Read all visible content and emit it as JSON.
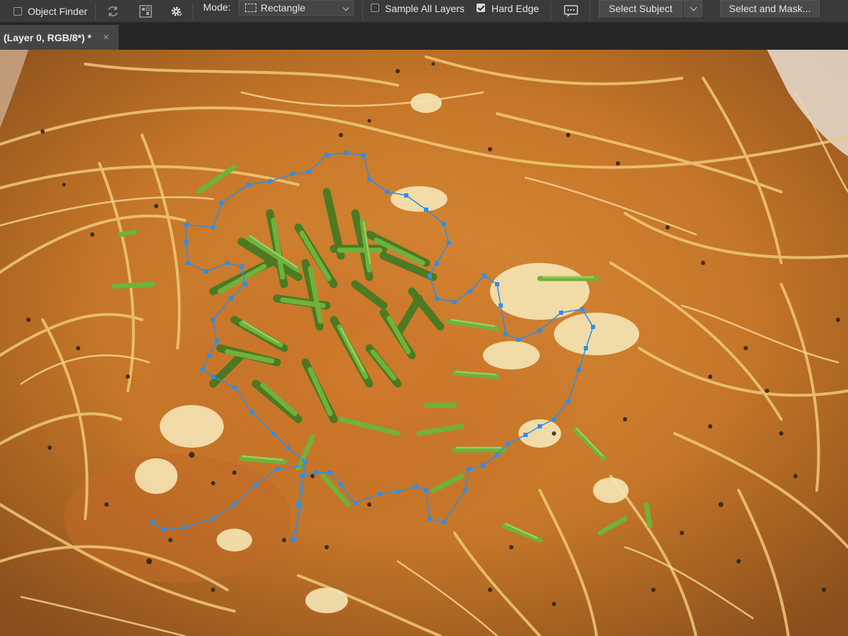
{
  "options_bar": {
    "object_finder_label": "Object Finder",
    "object_finder_checked": false,
    "mode_label": "Mode:",
    "mode_value": "Rectangle",
    "sample_all_layers_label": "Sample All Layers",
    "sample_all_layers_checked": false,
    "hard_edge_label": "Hard Edge",
    "hard_edge_checked": true,
    "select_subject_label": "Select Subject",
    "select_and_mask_label": "Select and Mask..."
  },
  "document_tab": {
    "title": "(Layer 0, RGB/8*) *",
    "close_glyph": "×"
  },
  "colors": {
    "selection_path": "#2f8fe6",
    "canvas_bg": "#c07228"
  }
}
